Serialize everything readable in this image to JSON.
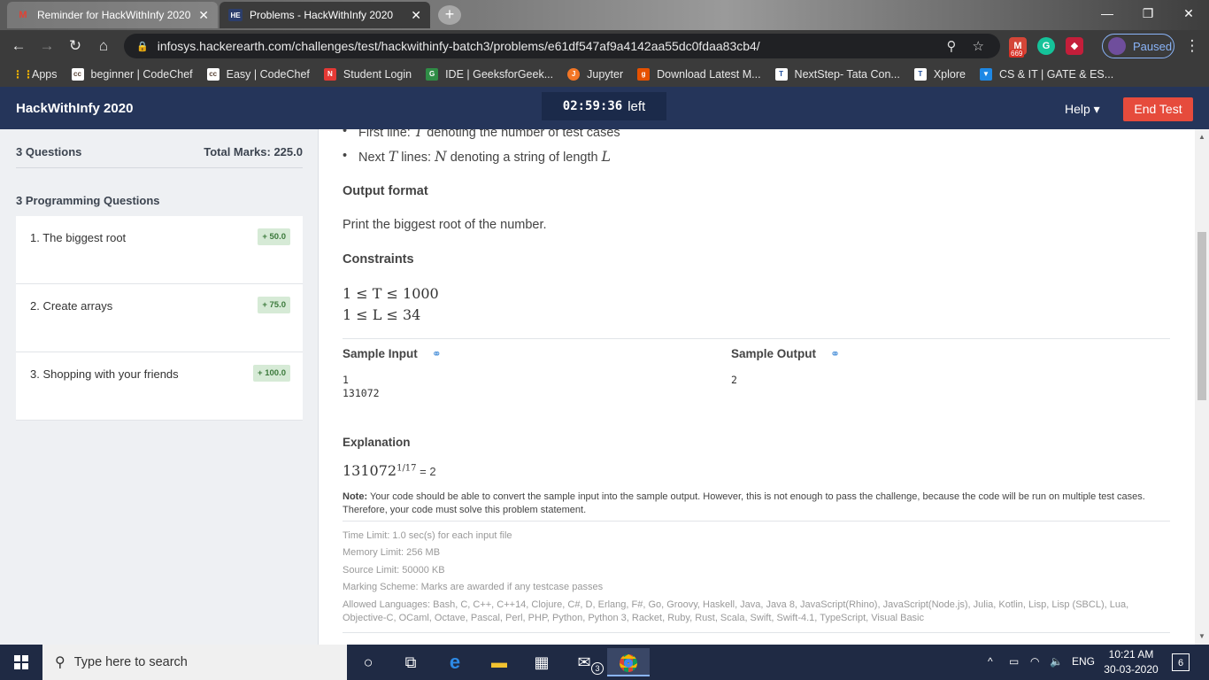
{
  "browser": {
    "tabs": [
      {
        "title": "Reminder for HackWithInfy 2020",
        "icon": "gmail-icon",
        "close": "✕"
      },
      {
        "title": "Problems - HackWithInfy 2020",
        "icon": "hackerearth-icon",
        "close": "✕"
      }
    ],
    "new_tab": "+",
    "url": "infosys.hackerearth.com/challenges/test/hackwithinfy-batch3/problems/e61df547af9a4142aa55dc0fdaa83cb4/",
    "ext_badge": "669",
    "profile_status": "Paused",
    "bookmarks": [
      {
        "label": "Apps",
        "icon": "apps-grid-icon"
      },
      {
        "label": "beginner | CodeChef",
        "icon": "codechef-icon"
      },
      {
        "label": "Easy | CodeChef",
        "icon": "codechef-icon"
      },
      {
        "label": "Student Login",
        "icon": "student-login-icon"
      },
      {
        "label": "IDE | GeeksforGeek...",
        "icon": "geeksforgeeks-icon"
      },
      {
        "label": "Jupyter",
        "icon": "jupyter-icon"
      },
      {
        "label": "Download Latest M...",
        "icon": "download-icon"
      },
      {
        "label": "NextStep- Tata Con...",
        "icon": "tata-icon"
      },
      {
        "label": "Xplore",
        "icon": "tata-icon"
      },
      {
        "label": "CS & IT | GATE & ES...",
        "icon": "bookmark-icon"
      }
    ]
  },
  "header": {
    "brand": "HackWithInfy 2020",
    "timer": "02:59:36",
    "timer_suffix": "left",
    "help": "Help ▾",
    "end_test": "End Test"
  },
  "sidebar": {
    "questions_count": "3 Questions",
    "total_marks": "Total Marks: 225.0",
    "section_title": "3 Programming Questions",
    "questions": [
      {
        "label": "1. The biggest root",
        "marks": "+ 50.0"
      },
      {
        "label": "2. Create arrays",
        "marks": "+ 75.0"
      },
      {
        "label": "3. Shopping with your friends",
        "marks": "+ 100.0"
      }
    ]
  },
  "problem": {
    "input_lines": [
      {
        "prefix": "First line: ",
        "var": "T",
        "suffix": " denoting the number of test cases"
      },
      {
        "prefix": "Next ",
        "var": "T",
        "mid": " lines: ",
        "var2": "N",
        "suffix": " denoting a string of length ",
        "var3": "L"
      }
    ],
    "output_title": "Output format",
    "output_text": "Print the biggest root of the number.",
    "constraints_title": "Constraints",
    "constraints": [
      "1 ≤ T ≤ 1000",
      "1 ≤ L ≤ 34"
    ],
    "sample_input_title": "Sample Input",
    "sample_input": "1\n131072",
    "sample_output_title": "Sample Output",
    "sample_output": "2",
    "explanation_title": "Explanation",
    "explanation_base": "131072",
    "explanation_exp": "1/17",
    "explanation_result": " = 2",
    "note_label": "Note:",
    "note_text": " Your code should be able to convert the sample input into the sample output. However, this is not enough to pass the challenge, because the code will be run on multiple test cases. Therefore, your code must solve this problem statement.",
    "time_limit": "Time Limit: 1.0 sec(s) for each input file",
    "memory_limit": "Memory Limit: 256 MB",
    "source_limit": "Source Limit: 50000 KB",
    "marking_scheme": "Marking Scheme: Marks are awarded if any testcase passes",
    "allowed_languages": "Allowed Languages: Bash, C, C++, C++14, Clojure, C#, D, Erlang, F#, Go, Groovy, Haskell, Java, Java 8, JavaScript(Rhino), JavaScript(Node.js), Julia, Kotlin, Lisp, Lisp (SBCL), Lua, Objective-C, OCaml, Octave, Pascal, Perl, PHP, Python, Python 3, Racket, Ruby, Rust, Scala, Swift, Swift-4.1, TypeScript, Visual Basic"
  },
  "taskbar": {
    "search_placeholder": "Type here to search",
    "mail_badge": "3",
    "language": "ENG",
    "time": "10:21 AM",
    "date": "30-03-2020",
    "notifications": "6"
  }
}
